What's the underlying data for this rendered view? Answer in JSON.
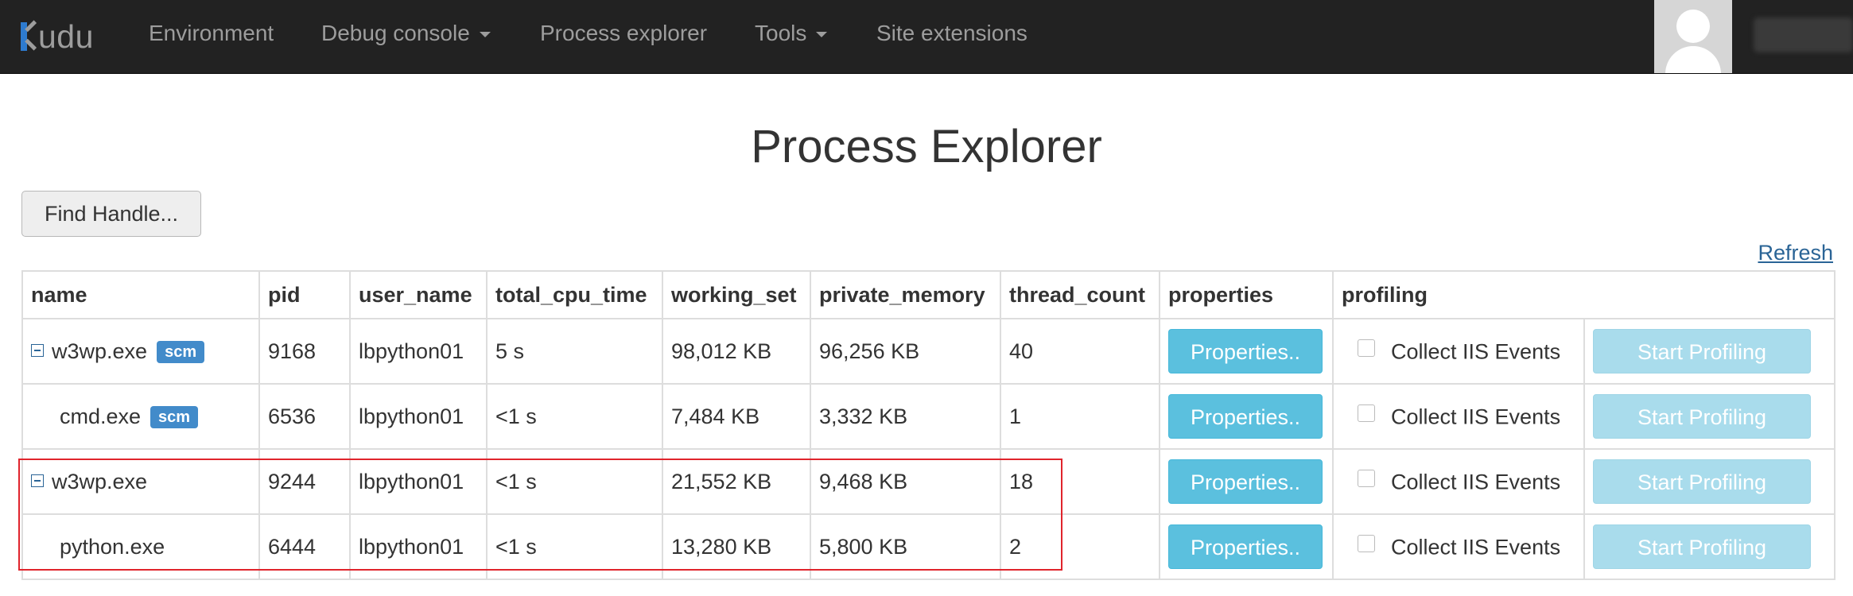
{
  "navbar": {
    "brand": "udu",
    "items": [
      {
        "label": "Environment",
        "dropdown": false
      },
      {
        "label": "Debug console",
        "dropdown": true
      },
      {
        "label": "Process explorer",
        "dropdown": false
      },
      {
        "label": "Tools",
        "dropdown": true
      },
      {
        "label": "Site extensions",
        "dropdown": false
      }
    ]
  },
  "page": {
    "title": "Process Explorer",
    "find_handle_label": "Find Handle...",
    "refresh_label": "Refresh"
  },
  "table": {
    "columns": [
      "name",
      "pid",
      "user_name",
      "total_cpu_time",
      "working_set",
      "private_memory",
      "thread_count",
      "properties",
      "profiling"
    ],
    "rows": [
      {
        "name": "w3wp.exe",
        "badge": "scm",
        "pid": "9168",
        "user_name": "lbpython01",
        "total_cpu_time": "5 s",
        "working_set": "98,012 KB",
        "private_memory": "96,256 KB",
        "thread_count": "40",
        "properties_label": "Properties..",
        "collect_label": "Collect IIS Events",
        "profiling_label": "Start Profiling"
      },
      {
        "name": "cmd.exe",
        "badge": "scm",
        "pid": "6536",
        "user_name": "lbpython01",
        "total_cpu_time": "<1 s",
        "working_set": "7,484 KB",
        "private_memory": "3,332 KB",
        "thread_count": "1",
        "properties_label": "Properties..",
        "collect_label": "Collect IIS Events",
        "profiling_label": "Start Profiling"
      },
      {
        "name": "w3wp.exe",
        "badge": "",
        "pid": "9244",
        "user_name": "lbpython01",
        "total_cpu_time": "<1 s",
        "working_set": "21,552 KB",
        "private_memory": "9,468 KB",
        "thread_count": "18",
        "properties_label": "Properties..",
        "collect_label": "Collect IIS Events",
        "profiling_label": "Start Profiling"
      },
      {
        "name": "python.exe",
        "badge": "",
        "pid": "6444",
        "user_name": "lbpython01",
        "total_cpu_time": "<1 s",
        "working_set": "13,280 KB",
        "private_memory": "5,800 KB",
        "thread_count": "2",
        "properties_label": "Properties..",
        "collect_label": "Collect IIS Events",
        "profiling_label": "Start Profiling"
      }
    ]
  },
  "icons": {
    "collapse": "minus-square-icon",
    "avatar": "user-silhouette-icon",
    "brand": "kudu-logo-icon"
  },
  "colors": {
    "navbar_bg": "#222222",
    "nav_text": "#9d9d9d",
    "brand_accent": "#2e7bcf",
    "badge_bg": "#428bca",
    "info_button": "#5bc0de",
    "disabled_button": "#a9dcec",
    "link": "#2a6496",
    "highlight": "#e0242c"
  }
}
